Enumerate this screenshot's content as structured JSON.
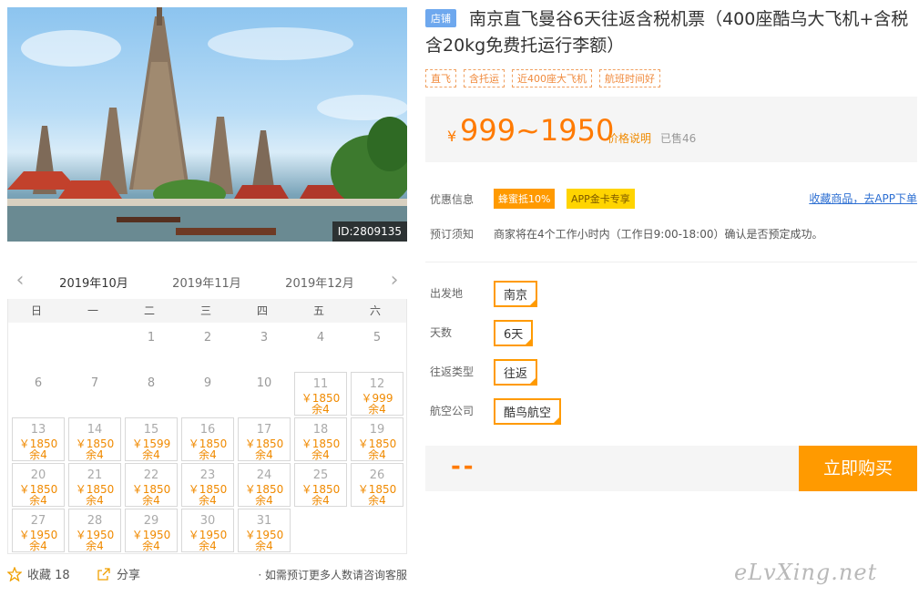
{
  "hero": {
    "id_label": "ID:2809135"
  },
  "calendar": {
    "prev_icon": "chevron-left-icon",
    "next_icon": "chevron-right-icon",
    "months": [
      "2019年10月",
      "2019年11月",
      "2019年12月"
    ],
    "active_month": 0,
    "weekdays": [
      "日",
      "一",
      "二",
      "三",
      "四",
      "五",
      "六"
    ],
    "cells": [
      {
        "day": ""
      },
      {
        "day": ""
      },
      {
        "day": "1"
      },
      {
        "day": "2"
      },
      {
        "day": "3"
      },
      {
        "day": "4"
      },
      {
        "day": "5"
      },
      {
        "day": "6"
      },
      {
        "day": "7"
      },
      {
        "day": "8"
      },
      {
        "day": "9"
      },
      {
        "day": "10"
      },
      {
        "day": "11",
        "price": "￥1850",
        "stock": "余4"
      },
      {
        "day": "12",
        "price": "￥999",
        "stock": "余4"
      },
      {
        "day": "13",
        "price": "￥1850",
        "stock": "余4"
      },
      {
        "day": "14",
        "price": "￥1850",
        "stock": "余4"
      },
      {
        "day": "15",
        "price": "￥1599",
        "stock": "余4"
      },
      {
        "day": "16",
        "price": "￥1850",
        "stock": "余4"
      },
      {
        "day": "17",
        "price": "￥1850",
        "stock": "余4"
      },
      {
        "day": "18",
        "price": "￥1850",
        "stock": "余4"
      },
      {
        "day": "19",
        "price": "￥1850",
        "stock": "余4"
      },
      {
        "day": "20",
        "price": "￥1850",
        "stock": "余4"
      },
      {
        "day": "21",
        "price": "￥1850",
        "stock": "余4"
      },
      {
        "day": "22",
        "price": "￥1850",
        "stock": "余4"
      },
      {
        "day": "23",
        "price": "￥1850",
        "stock": "余4"
      },
      {
        "day": "24",
        "price": "￥1850",
        "stock": "余4"
      },
      {
        "day": "25",
        "price": "￥1850",
        "stock": "余4"
      },
      {
        "day": "26",
        "price": "￥1850",
        "stock": "余4"
      },
      {
        "day": "27",
        "price": "￥1950",
        "stock": "余4"
      },
      {
        "day": "28",
        "price": "￥1950",
        "stock": "余4"
      },
      {
        "day": "29",
        "price": "￥1950",
        "stock": "余4"
      },
      {
        "day": "30",
        "price": "￥1950",
        "stock": "余4"
      },
      {
        "day": "31",
        "price": "￥1950",
        "stock": "余4"
      }
    ]
  },
  "footer": {
    "favorite_label": "收藏",
    "favorite_count": "18",
    "share_label": "分享",
    "note": "· 如需预订更多人数请咨询客服"
  },
  "product": {
    "shop_badge": "店铺",
    "title": "南京直飞曼谷6天往返含税机票（400座酷乌大飞机+含税含20kg免费托运行李额）",
    "tags": [
      "直飞",
      "含托运",
      "近400座大飞机",
      "航班时间好"
    ],
    "price_symbol": "¥",
    "price_range": "999~1950",
    "price_explain": "价格说明",
    "sold": "已售46"
  },
  "promo": {
    "label": "优惠信息",
    "badges": [
      "蜂蜜抵10%",
      "APP金卡专享"
    ],
    "app_link": "收藏商品，去APP下单"
  },
  "booking_notice": {
    "label": "预订须知",
    "text": "商家将在4个工作小时内（工作日9:00-18:00）确认是否预定成功。"
  },
  "options": [
    {
      "label": "出发地",
      "value": "南京"
    },
    {
      "label": "天数",
      "value": "6天"
    },
    {
      "label": "往返类型",
      "value": "往返"
    },
    {
      "label": "航空公司",
      "value": "酷鸟航空"
    }
  ],
  "buy": {
    "quantity_display": "--",
    "button_label": "立即购买"
  },
  "watermark": "eLvXing.net",
  "colors": {
    "accent": "#ff9a00",
    "price": "#ff7a00",
    "link": "#2d6fd2",
    "badge": "#6ea8ee"
  }
}
